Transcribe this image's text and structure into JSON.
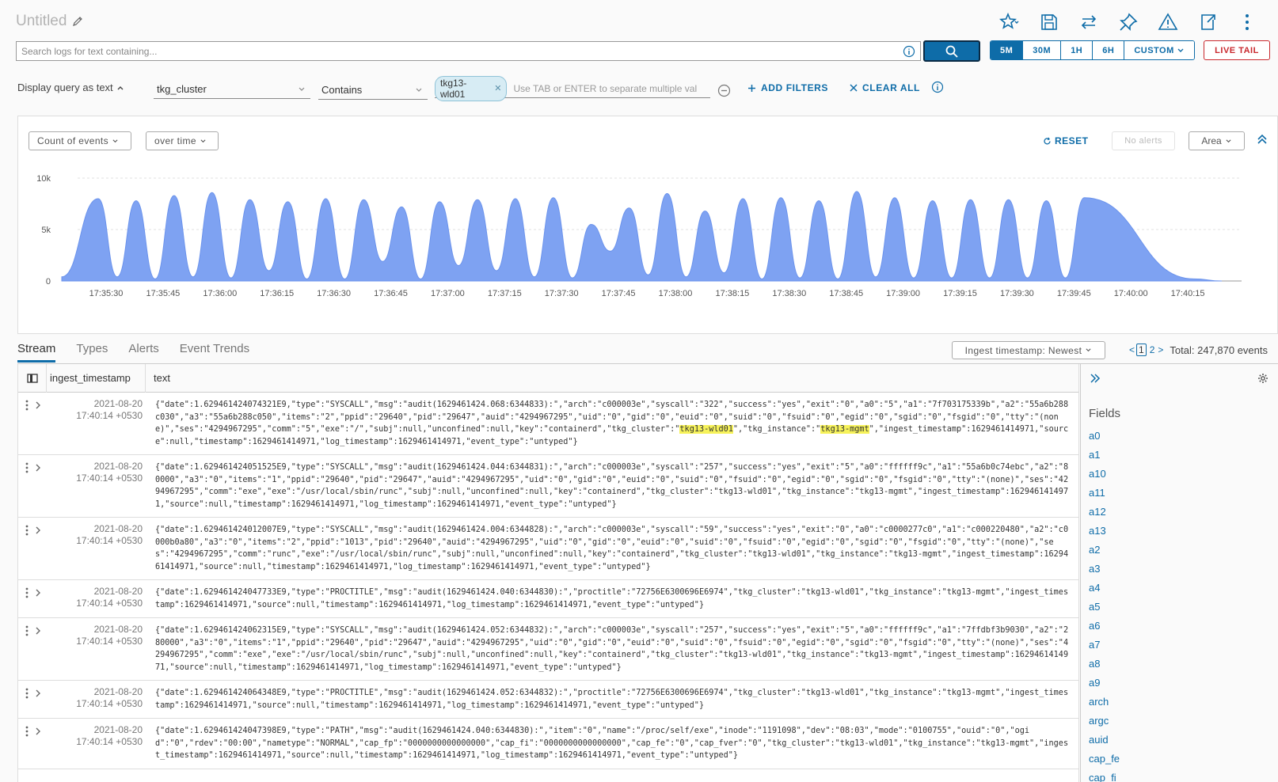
{
  "header": {
    "title": "Untitled",
    "icons": [
      "favorite-star-icon",
      "save-icon",
      "compare-icon",
      "pin-icon",
      "alert-icon",
      "export-icon",
      "more-icon"
    ]
  },
  "search": {
    "placeholder": "Search logs for text containing...",
    "value": ""
  },
  "time_ranges": [
    "5M",
    "30M",
    "1H",
    "6H",
    "CUSTOM"
  ],
  "time_range_selected": "5M",
  "live_tail_label": "LIVE TAIL",
  "filter": {
    "display_query_label": "Display query as text",
    "field": "tkg_cluster",
    "operator": "Contains",
    "chip": "tkg13-wld01",
    "value_placeholder": "Use TAB or ENTER to separate multiple val",
    "add_filters_label": "ADD FILTERS",
    "clear_all_label": "CLEAR ALL"
  },
  "chart_controls": {
    "metric": "Count of events",
    "grouping": "over time",
    "reset_label": "RESET",
    "alerts_label": "No alerts",
    "chart_type": "Area"
  },
  "chart_data": {
    "type": "area",
    "y_ticks": [
      "0",
      "5k",
      "10k"
    ],
    "ylim": [
      0,
      10000
    ],
    "x_tick_labels": [
      "17:35:30",
      "17:35:45",
      "17:36:00",
      "17:36:15",
      "17:36:30",
      "17:36:45",
      "17:37:00",
      "17:37:15",
      "17:37:30",
      "17:37:45",
      "17:38:00",
      "17:38:15",
      "17:38:30",
      "17:38:45",
      "17:39:00",
      "17:39:15",
      "17:39:30",
      "17:39:45",
      "17:40:00",
      "17:40:15"
    ],
    "peaks": [
      8000,
      7800,
      8300,
      8600,
      7900,
      7700,
      8000,
      7900,
      7200,
      7700,
      7900,
      8000,
      8100,
      5500,
      7100,
      8500,
      6800,
      8000,
      8100,
      7800,
      8700,
      8100,
      7800,
      7900,
      7900,
      7800,
      8100
    ],
    "troughs": [
      400,
      200,
      400,
      300,
      1000,
      200,
      200,
      1900,
      200,
      1500,
      1000,
      400,
      300,
      2900,
      600,
      400,
      800,
      200,
      300,
      200,
      400,
      300,
      300,
      300,
      300,
      300
    ],
    "color": "#7ea2f2",
    "grid": true
  },
  "tabs": [
    "Stream",
    "Types",
    "Alerts",
    "Event Trends"
  ],
  "active_tab": "Stream",
  "sort_label": "Ingest timestamp: Newest",
  "pager": {
    "pages": [
      "1",
      "2"
    ],
    "current": "1",
    "total": "Total: 247,870 events"
  },
  "table": {
    "columns": [
      "ingest_timestamp",
      "text"
    ],
    "rows": [
      {
        "date": "2021-08-20",
        "time": "17:40:14 +0530",
        "parts": [
          "{\"date\":1.629461424074321E9,\"type\":\"SYSCALL\",\"msg\":\"audit(1629461424.068:6344833):\",\"arch\":\"c000003e\",\"syscall\":\"322\",\"success\":\"yes\",\"exit\":\"0\",\"a0\":\"5\",\"a1\":\"7f703175339b\",\"a2\":\"55a6b288c030\",\"a3\":\"55a6b288c050\",\"items\":\"2\",\"ppid\":\"29640\",\"pid\":\"29647\",\"auid\":\"4294967295\",\"uid\":\"0\",\"gid\":\"0\",\"euid\":\"0\",\"suid\":\"0\",\"fsuid\":\"0\",\"egid\":\"0\",\"sgid\":\"0\",\"fsgid\":\"0\",\"tty\":\"(none)\",\"ses\":\"4294967295\",\"comm\":\"5\",\"exe\":\"/\",\"subj\":null,\"unconfined\":null,\"key\":\"containerd\",\"tkg_cluster\":\"",
          "tkg13-wld01",
          "\",\"tkg_instance\":\"",
          "tkg13-mgmt",
          "\",\"ingest_timestamp\":1629461414971,\"source\":null,\"timestamp\":1629461414971,\"log_timestamp\":1629461414971,\"event_type\":\"untyped\"}"
        ]
      },
      {
        "date": "2021-08-20",
        "time": "17:40:14 +0530",
        "text": "{\"date\":1.629461424051525E9,\"type\":\"SYSCALL\",\"msg\":\"audit(1629461424.044:6344831):\",\"arch\":\"c000003e\",\"syscall\":\"257\",\"success\":\"yes\",\"exit\":\"5\",\"a0\":\"ffffff9c\",\"a1\":\"55a6b0c74ebc\",\"a2\":\"80000\",\"a3\":\"0\",\"items\":\"1\",\"ppid\":\"29640\",\"pid\":\"29647\",\"auid\":\"4294967295\",\"uid\":\"0\",\"gid\":\"0\",\"euid\":\"0\",\"suid\":\"0\",\"fsuid\":\"0\",\"egid\":\"0\",\"sgid\":\"0\",\"fsgid\":\"0\",\"tty\":\"(none)\",\"ses\":\"4294967295\",\"comm\":\"exe\",\"exe\":\"/usr/local/sbin/runc\",\"subj\":null,\"unconfined\":null,\"key\":\"containerd\",\"tkg_cluster\":\"tkg13-wld01\",\"tkg_instance\":\"tkg13-mgmt\",\"ingest_timestamp\":1629461414971,\"source\":null,\"timestamp\":1629461414971,\"log_timestamp\":1629461414971,\"event_type\":\"untyped\"}"
      },
      {
        "date": "2021-08-20",
        "time": "17:40:14 +0530",
        "text": "{\"date\":1.629461424012007E9,\"type\":\"SYSCALL\",\"msg\":\"audit(1629461424.004:6344828):\",\"arch\":\"c000003e\",\"syscall\":\"59\",\"success\":\"yes\",\"exit\":\"0\",\"a0\":\"c0000277c0\",\"a1\":\"c000220480\",\"a2\":\"c0000b0a80\",\"a3\":\"0\",\"items\":\"2\",\"ppid\":\"1013\",\"pid\":\"29640\",\"auid\":\"4294967295\",\"uid\":\"0\",\"gid\":\"0\",\"euid\":\"0\",\"suid\":\"0\",\"fsuid\":\"0\",\"egid\":\"0\",\"sgid\":\"0\",\"fsgid\":\"0\",\"tty\":\"(none)\",\"ses\":\"4294967295\",\"comm\":\"runc\",\"exe\":\"/usr/local/sbin/runc\",\"subj\":null,\"unconfined\":null,\"key\":\"containerd\",\"tkg_cluster\":\"tkg13-wld01\",\"tkg_instance\":\"tkg13-mgmt\",\"ingest_timestamp\":1629461414971,\"source\":null,\"timestamp\":1629461414971,\"log_timestamp\":1629461414971,\"event_type\":\"untyped\"}"
      },
      {
        "date": "2021-08-20",
        "time": "17:40:14 +0530",
        "text": "{\"date\":1.629461424047733E9,\"type\":\"PROCTITLE\",\"msg\":\"audit(1629461424.040:6344830):\",\"proctitle\":\"72756E6300696E6974\",\"tkg_cluster\":\"tkg13-wld01\",\"tkg_instance\":\"tkg13-mgmt\",\"ingest_timestamp\":1629461414971,\"source\":null,\"timestamp\":1629461414971,\"log_timestamp\":1629461414971,\"event_type\":\"untyped\"}"
      },
      {
        "date": "2021-08-20",
        "time": "17:40:14 +0530",
        "text": "{\"date\":1.629461424062315E9,\"type\":\"SYSCALL\",\"msg\":\"audit(1629461424.052:6344832):\",\"arch\":\"c000003e\",\"syscall\":\"257\",\"success\":\"yes\",\"exit\":\"5\",\"a0\":\"ffffff9c\",\"a1\":\"7ffdbf3b9030\",\"a2\":\"280000\",\"a3\":\"0\",\"items\":\"1\",\"ppid\":\"29640\",\"pid\":\"29647\",\"auid\":\"4294967295\",\"uid\":\"0\",\"gid\":\"0\",\"euid\":\"0\",\"suid\":\"0\",\"fsuid\":\"0\",\"egid\":\"0\",\"sgid\":\"0\",\"fsgid\":\"0\",\"tty\":\"(none)\",\"ses\":\"4294967295\",\"comm\":\"exe\",\"exe\":\"/usr/local/sbin/runc\",\"subj\":null,\"unconfined\":null,\"key\":\"containerd\",\"tkg_cluster\":\"tkg13-wld01\",\"tkg_instance\":\"tkg13-mgmt\",\"ingest_timestamp\":1629461414971,\"source\":null,\"timestamp\":1629461414971,\"log_timestamp\":1629461414971,\"event_type\":\"untyped\"}"
      },
      {
        "date": "2021-08-20",
        "time": "17:40:14 +0530",
        "text": "{\"date\":1.629461424064348E9,\"type\":\"PROCTITLE\",\"msg\":\"audit(1629461424.052:6344832):\",\"proctitle\":\"72756E6300696E6974\",\"tkg_cluster\":\"tkg13-wld01\",\"tkg_instance\":\"tkg13-mgmt\",\"ingest_timestamp\":1629461414971,\"source\":null,\"timestamp\":1629461414971,\"log_timestamp\":1629461414971,\"event_type\":\"untyped\"}"
      },
      {
        "date": "2021-08-20",
        "time": "17:40:14 +0530",
        "text": "{\"date\":1.629461424047398E9,\"type\":\"PATH\",\"msg\":\"audit(1629461424.040:6344830):\",\"item\":\"0\",\"name\":\"/proc/self/exe\",\"inode\":\"1191098\",\"dev\":\"08:03\",\"mode\":\"0100755\",\"ouid\":\"0\",\"ogid\":\"0\",\"rdev\":\"00:00\",\"nametype\":\"NORMAL\",\"cap_fp\":\"0000000000000000\",\"cap_fi\":\"0000000000000000\",\"cap_fe\":\"0\",\"cap_fver\":\"0\",\"tkg_cluster\":\"tkg13-wld01\",\"tkg_instance\":\"tkg13-mgmt\",\"ingest_timestamp\":1629461414971,\"source\":null,\"timestamp\":1629461414971,\"log_timestamp\":1629461414971,\"event_type\":\"untyped\"}"
      }
    ]
  },
  "fields_panel": {
    "title": "Fields",
    "items": [
      "a0",
      "a1",
      "a10",
      "a11",
      "a12",
      "a13",
      "a2",
      "a3",
      "a4",
      "a5",
      "a6",
      "a7",
      "a8",
      "a9",
      "arch",
      "argc",
      "auid",
      "cap_fe",
      "cap_fi"
    ]
  },
  "colors": {
    "accent": "#0e6ca8",
    "live_tail": "#c9282d",
    "chart_fill": "#7ea2f2",
    "highlight": "#f6f25a"
  }
}
